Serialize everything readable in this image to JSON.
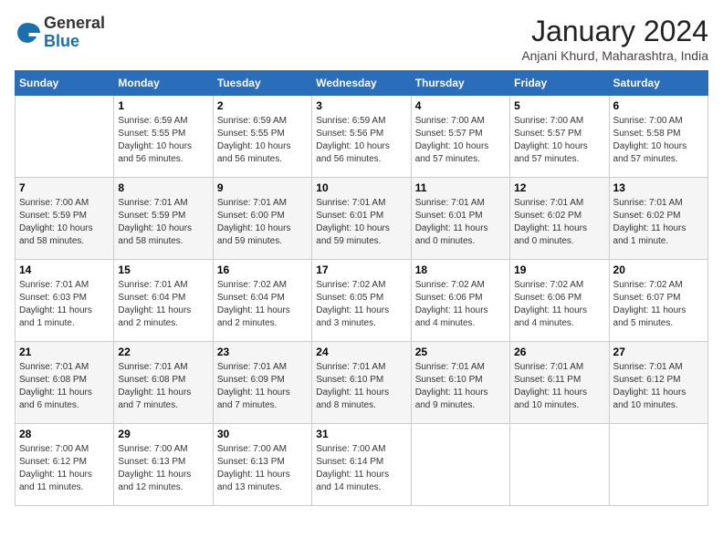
{
  "header": {
    "logo_general": "General",
    "logo_blue": "Blue",
    "month_title": "January 2024",
    "location": "Anjani Khurd, Maharashtra, India"
  },
  "days_of_week": [
    "Sunday",
    "Monday",
    "Tuesday",
    "Wednesday",
    "Thursday",
    "Friday",
    "Saturday"
  ],
  "weeks": [
    [
      {
        "day": "",
        "info": ""
      },
      {
        "day": "1",
        "info": "Sunrise: 6:59 AM\nSunset: 5:55 PM\nDaylight: 10 hours\nand 56 minutes."
      },
      {
        "day": "2",
        "info": "Sunrise: 6:59 AM\nSunset: 5:55 PM\nDaylight: 10 hours\nand 56 minutes."
      },
      {
        "day": "3",
        "info": "Sunrise: 6:59 AM\nSunset: 5:56 PM\nDaylight: 10 hours\nand 56 minutes."
      },
      {
        "day": "4",
        "info": "Sunrise: 7:00 AM\nSunset: 5:57 PM\nDaylight: 10 hours\nand 57 minutes."
      },
      {
        "day": "5",
        "info": "Sunrise: 7:00 AM\nSunset: 5:57 PM\nDaylight: 10 hours\nand 57 minutes."
      },
      {
        "day": "6",
        "info": "Sunrise: 7:00 AM\nSunset: 5:58 PM\nDaylight: 10 hours\nand 57 minutes."
      }
    ],
    [
      {
        "day": "7",
        "info": "Sunrise: 7:00 AM\nSunset: 5:59 PM\nDaylight: 10 hours\nand 58 minutes."
      },
      {
        "day": "8",
        "info": "Sunrise: 7:01 AM\nSunset: 5:59 PM\nDaylight: 10 hours\nand 58 minutes."
      },
      {
        "day": "9",
        "info": "Sunrise: 7:01 AM\nSunset: 6:00 PM\nDaylight: 10 hours\nand 59 minutes."
      },
      {
        "day": "10",
        "info": "Sunrise: 7:01 AM\nSunset: 6:01 PM\nDaylight: 10 hours\nand 59 minutes."
      },
      {
        "day": "11",
        "info": "Sunrise: 7:01 AM\nSunset: 6:01 PM\nDaylight: 11 hours\nand 0 minutes."
      },
      {
        "day": "12",
        "info": "Sunrise: 7:01 AM\nSunset: 6:02 PM\nDaylight: 11 hours\nand 0 minutes."
      },
      {
        "day": "13",
        "info": "Sunrise: 7:01 AM\nSunset: 6:02 PM\nDaylight: 11 hours\nand 1 minute."
      }
    ],
    [
      {
        "day": "14",
        "info": "Sunrise: 7:01 AM\nSunset: 6:03 PM\nDaylight: 11 hours\nand 1 minute."
      },
      {
        "day": "15",
        "info": "Sunrise: 7:01 AM\nSunset: 6:04 PM\nDaylight: 11 hours\nand 2 minutes."
      },
      {
        "day": "16",
        "info": "Sunrise: 7:02 AM\nSunset: 6:04 PM\nDaylight: 11 hours\nand 2 minutes."
      },
      {
        "day": "17",
        "info": "Sunrise: 7:02 AM\nSunset: 6:05 PM\nDaylight: 11 hours\nand 3 minutes."
      },
      {
        "day": "18",
        "info": "Sunrise: 7:02 AM\nSunset: 6:06 PM\nDaylight: 11 hours\nand 4 minutes."
      },
      {
        "day": "19",
        "info": "Sunrise: 7:02 AM\nSunset: 6:06 PM\nDaylight: 11 hours\nand 4 minutes."
      },
      {
        "day": "20",
        "info": "Sunrise: 7:02 AM\nSunset: 6:07 PM\nDaylight: 11 hours\nand 5 minutes."
      }
    ],
    [
      {
        "day": "21",
        "info": "Sunrise: 7:01 AM\nSunset: 6:08 PM\nDaylight: 11 hours\nand 6 minutes."
      },
      {
        "day": "22",
        "info": "Sunrise: 7:01 AM\nSunset: 6:08 PM\nDaylight: 11 hours\nand 7 minutes."
      },
      {
        "day": "23",
        "info": "Sunrise: 7:01 AM\nSunset: 6:09 PM\nDaylight: 11 hours\nand 7 minutes."
      },
      {
        "day": "24",
        "info": "Sunrise: 7:01 AM\nSunset: 6:10 PM\nDaylight: 11 hours\nand 8 minutes."
      },
      {
        "day": "25",
        "info": "Sunrise: 7:01 AM\nSunset: 6:10 PM\nDaylight: 11 hours\nand 9 minutes."
      },
      {
        "day": "26",
        "info": "Sunrise: 7:01 AM\nSunset: 6:11 PM\nDaylight: 11 hours\nand 10 minutes."
      },
      {
        "day": "27",
        "info": "Sunrise: 7:01 AM\nSunset: 6:12 PM\nDaylight: 11 hours\nand 10 minutes."
      }
    ],
    [
      {
        "day": "28",
        "info": "Sunrise: 7:00 AM\nSunset: 6:12 PM\nDaylight: 11 hours\nand 11 minutes."
      },
      {
        "day": "29",
        "info": "Sunrise: 7:00 AM\nSunset: 6:13 PM\nDaylight: 11 hours\nand 12 minutes."
      },
      {
        "day": "30",
        "info": "Sunrise: 7:00 AM\nSunset: 6:13 PM\nDaylight: 11 hours\nand 13 minutes."
      },
      {
        "day": "31",
        "info": "Sunrise: 7:00 AM\nSunset: 6:14 PM\nDaylight: 11 hours\nand 14 minutes."
      },
      {
        "day": "",
        "info": ""
      },
      {
        "day": "",
        "info": ""
      },
      {
        "day": "",
        "info": ""
      }
    ]
  ]
}
